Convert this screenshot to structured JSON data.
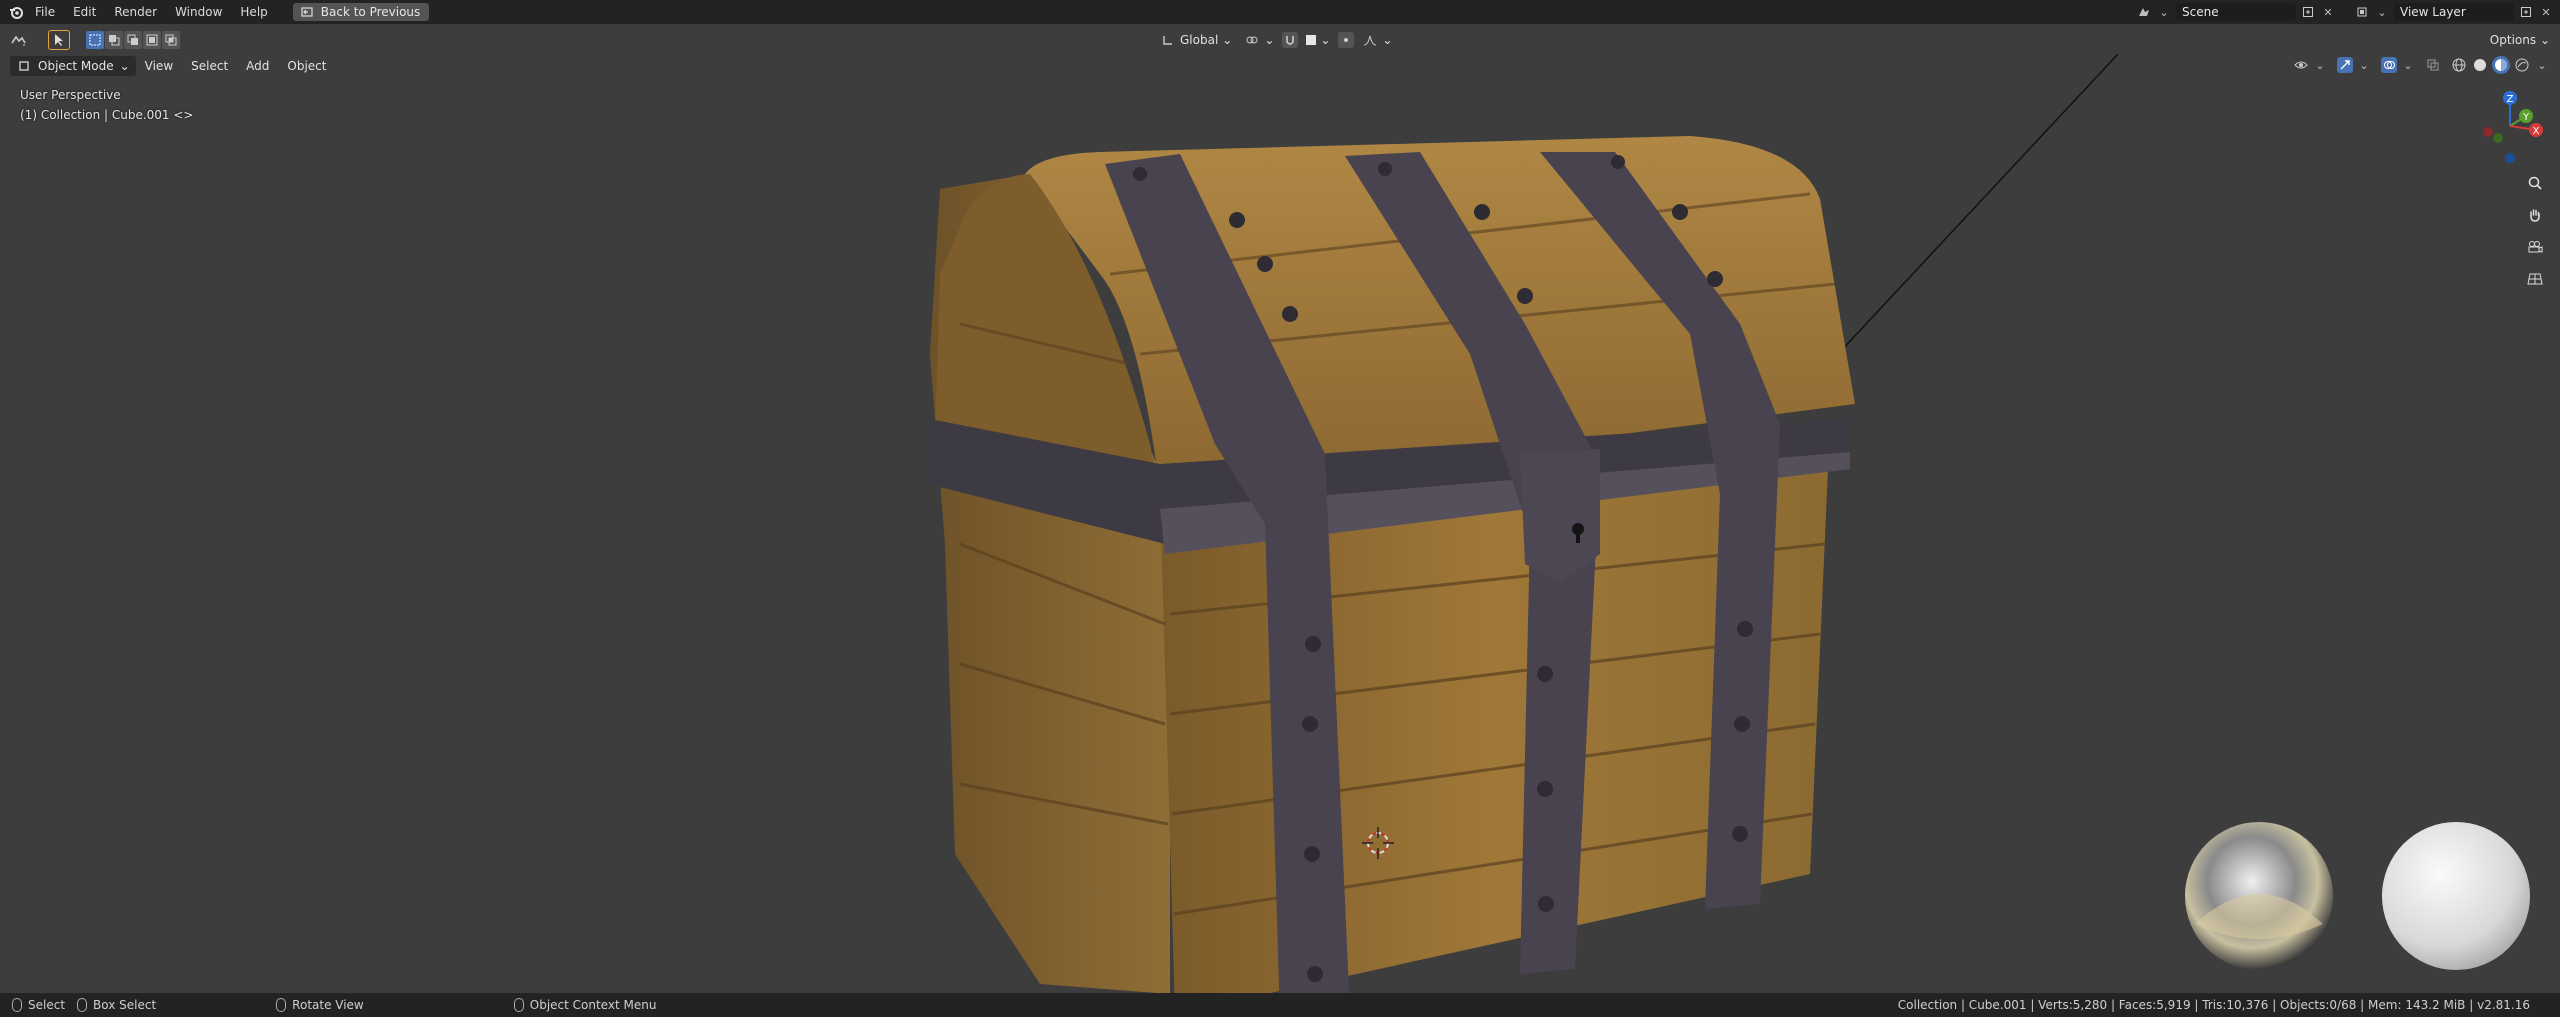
{
  "topbar": {
    "menus": [
      "File",
      "Edit",
      "Render",
      "Window",
      "Help"
    ],
    "back_label": "Back to Previous",
    "scene_label": "Scene",
    "view_layer_label": "View Layer"
  },
  "toolheader": {
    "orientation": "Global",
    "options_label": "Options"
  },
  "viewheader": {
    "mode": "Object Mode",
    "menus": [
      "View",
      "Select",
      "Add",
      "Object"
    ]
  },
  "overlay": {
    "perspective": "User Perspective",
    "collection": "(1) Collection | Cube.001 <>"
  },
  "gizmo": {
    "z": "Z",
    "y": "Y",
    "x": "X"
  },
  "statusbar": {
    "select": "Select",
    "box_select": "Box Select",
    "rotate_view": "Rotate View",
    "context_menu": "Object Context Menu",
    "stats": "Collection | Cube.001 | Verts:5,280 | Faces:5,919 | Tris:10,376 | Objects:0/68 | Mem: 143.2 MiB | v2.81.16"
  },
  "colors": {
    "accent": "#4772b3",
    "wood": "#8a6a34",
    "metal": "#4a4650"
  }
}
